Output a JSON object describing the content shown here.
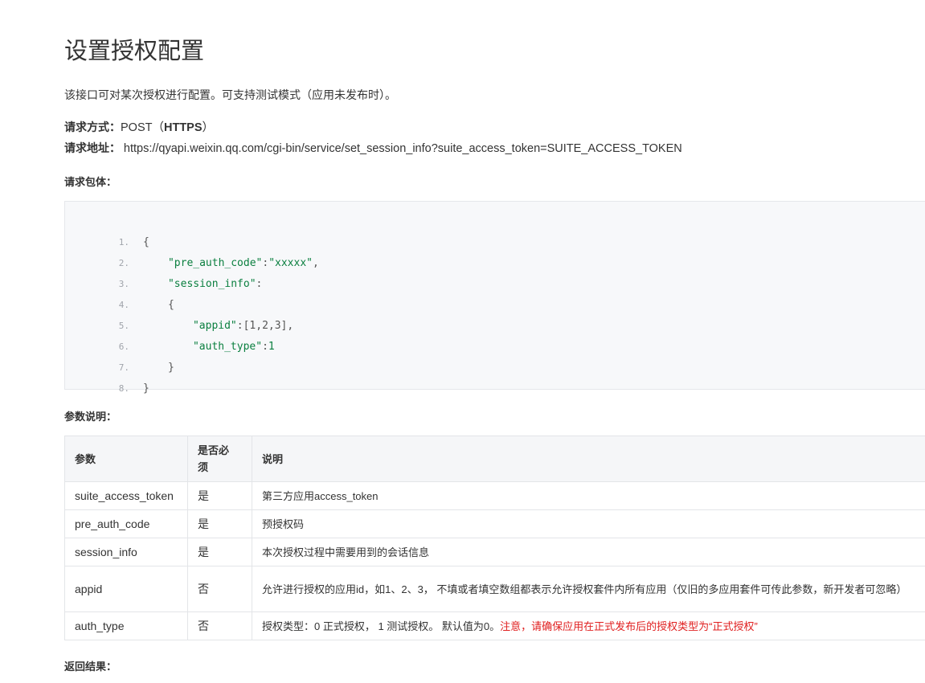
{
  "page": {
    "title": "设置授权配置",
    "intro": "该接口可对某次授权进行配置。可支持测试模式（应用未发布时）。"
  },
  "request": {
    "method_label": "请求方式：",
    "method_value": "POST（",
    "method_protocol": "HTTPS",
    "method_close": "）",
    "url_label": "请求地址：",
    "url_value": "https://qyapi.weixin.qq.com/cgi-bin/service/set_session_info?suite_access_token=SUITE_ACCESS_TOKEN"
  },
  "body_label": "请求包体：",
  "code": {
    "lines": [
      {
        "n": "1.",
        "text": "{"
      },
      {
        "n": "2.",
        "key": "\"pre_auth_code\"",
        "sep": ":",
        "val": "\"xxxxx\"",
        "end": ","
      },
      {
        "n": "3.",
        "key": "\"session_info\"",
        "sep": ":",
        "val": "",
        "end": ""
      },
      {
        "n": "4.",
        "text": "{"
      },
      {
        "n": "5.",
        "key": "\"appid\"",
        "sep": ":",
        "val": "[1,2,3]",
        "end": ","
      },
      {
        "n": "6.",
        "key": "\"auth_type\"",
        "sep": ":",
        "val": "1",
        "end": ""
      },
      {
        "n": "7.",
        "text": "}"
      },
      {
        "n": "8.",
        "text": "}"
      }
    ]
  },
  "params_label": "参数说明：",
  "table": {
    "headers": [
      "参数",
      "是否必须",
      "说明"
    ],
    "header_required_line1": "是否必",
    "header_required_line2": "须",
    "rows": [
      {
        "param": "suite_access_token",
        "required": "是",
        "desc": "第三方应用access_token"
      },
      {
        "param": "pre_auth_code",
        "required": "是",
        "desc": "预授权码"
      },
      {
        "param": "session_info",
        "required": "是",
        "desc": "本次授权过程中需要用到的会话信息"
      },
      {
        "param": "appid",
        "required": "否",
        "desc": "允许进行授权的应用id，如1、2、3， 不填或者填空数组都表示允许授权套件内所有应用（仅旧的多应用套件可传此参数，新开发者可忽略）"
      },
      {
        "param": "auth_type",
        "required": "否",
        "desc": "授权类型：0 正式授权， 1 测试授权。 默认值为0。",
        "warning": "注意，请确保应用在正式发布后的授权类型为“正式授权”"
      }
    ]
  },
  "return_label": "返回结果："
}
